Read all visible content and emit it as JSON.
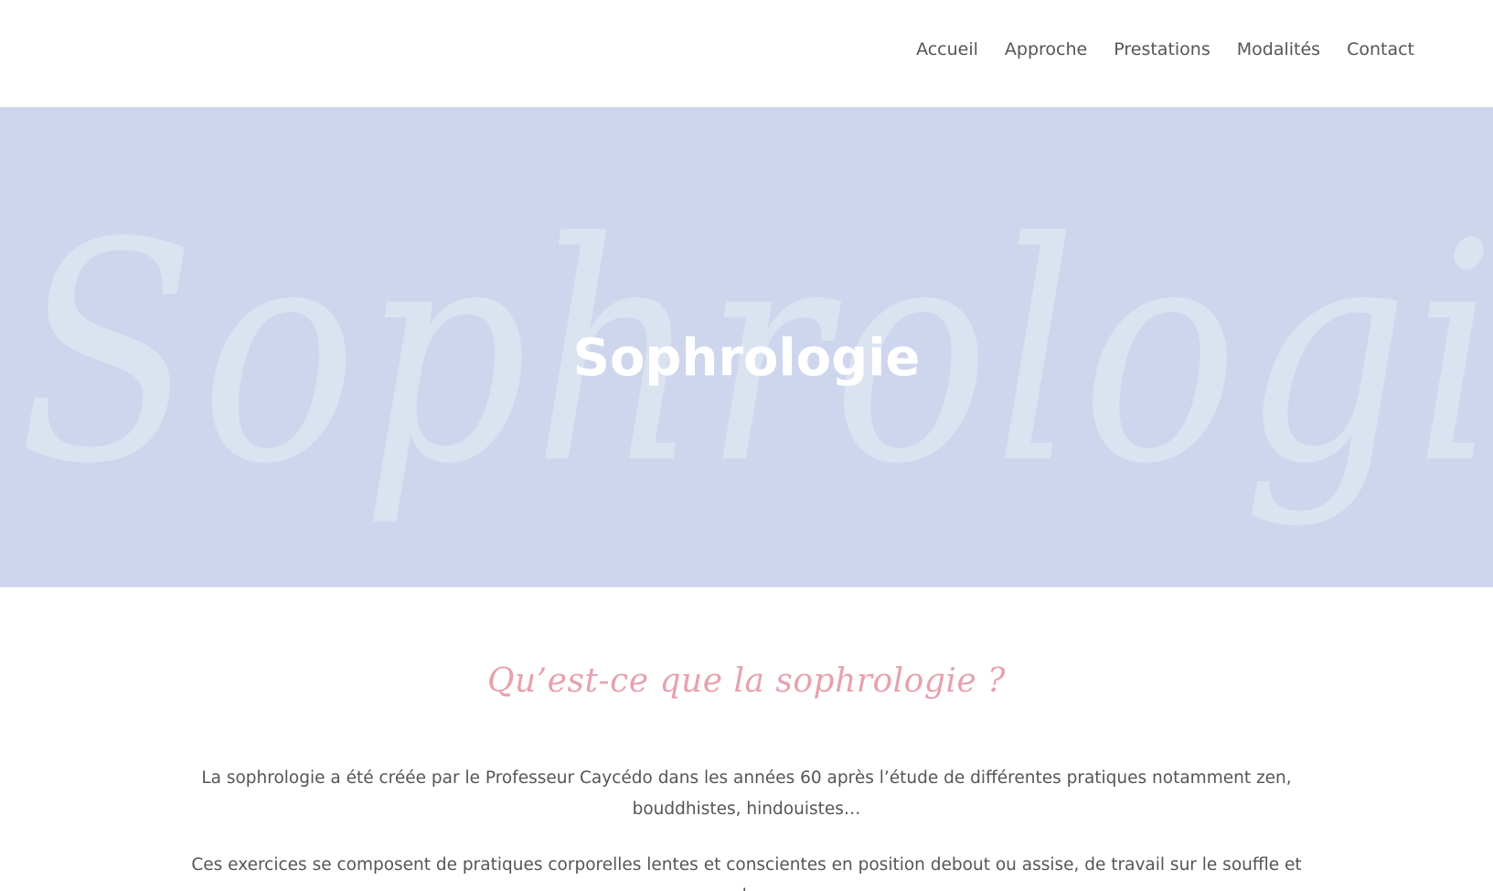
{
  "nav": {
    "items": [
      {
        "label": "Accueil"
      },
      {
        "label": "Approche"
      },
      {
        "label": "Prestations"
      },
      {
        "label": "Modalités"
      },
      {
        "label": "Contact"
      }
    ]
  },
  "hero": {
    "watermark": "Sophrologie",
    "title": "Sophrologie"
  },
  "content": {
    "heading": "Qu’est-ce que la sophrologie ?",
    "paragraph1": "La sophrologie a été créée par le Professeur Caycédo dans les années 60 après l’étude de différentes pratiques notamment zen, bouddhistes, hindouistes…",
    "paragraph2": "Ces exercices se composent de pratiques corporelles lentes et conscientes en position debout ou assise, de travail sur le souffle et de"
  },
  "colors": {
    "hero_background": "#ced6ee",
    "heading_accent": "#e6a2ad",
    "text": "#555555"
  }
}
